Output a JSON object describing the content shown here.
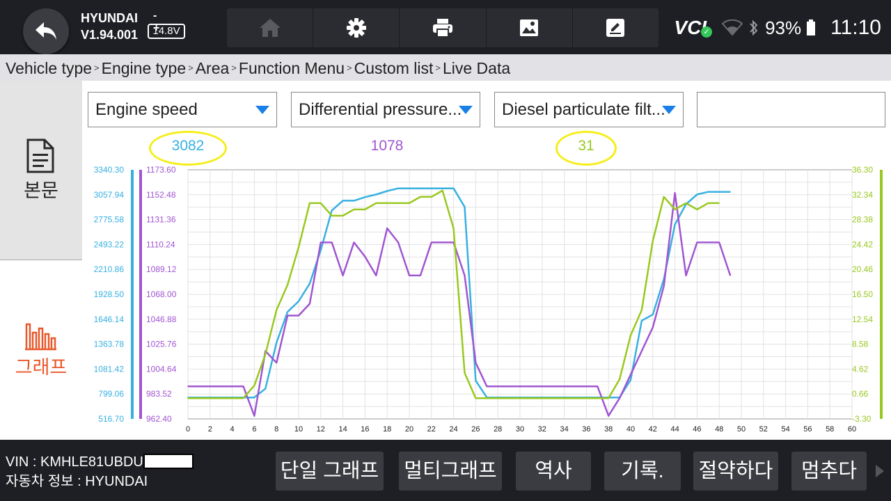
{
  "header": {
    "brand": "HYUNDAI",
    "version": "V1.94.001",
    "battery_signs": "- +",
    "voltage": "14.8V",
    "status_vci": "VCI",
    "battery_percent": "93%",
    "clock": "11:10",
    "toolbar_icons": [
      "home-icon",
      "gear-icon",
      "print-icon",
      "image-icon",
      "edit-icon"
    ]
  },
  "breadcrumb": [
    "Vehicle type",
    "Engine type",
    "Area",
    "Function Menu",
    "Custom list",
    "Live Data"
  ],
  "breadcrumb_separator": ">",
  "side": {
    "text_label": "본문",
    "graph_label": "그래프",
    "accent": "#e8582a"
  },
  "selectors": [
    {
      "label": "Engine speed"
    },
    {
      "label": "Differential pressure..."
    },
    {
      "label": "Diesel particulate filt..."
    },
    {
      "label": ""
    }
  ],
  "current_values": [
    "3082",
    "1078",
    "31"
  ],
  "chart_data": {
    "type": "line",
    "x_ticks": [
      0,
      2,
      4,
      6,
      8,
      10,
      12,
      14,
      16,
      18,
      20,
      22,
      24,
      26,
      28,
      30,
      32,
      34,
      36,
      38,
      40,
      42,
      44,
      46,
      48,
      50,
      52,
      54,
      56,
      58,
      60
    ],
    "xlim": [
      0,
      60
    ],
    "grid": true,
    "axes": [
      {
        "color": "#37b0e0",
        "ylim": [
          516.7,
          3340.3
        ],
        "ticks": [
          "3340.30",
          "3057.94",
          "2775.58",
          "2493.22",
          "2210.86",
          "1928.50",
          "1646.14",
          "1363.78",
          "1081.42",
          "799.06",
          "516.70"
        ]
      },
      {
        "color": "#a055d0",
        "ylim": [
          962.4,
          1173.6
        ],
        "ticks": [
          "1173.60",
          "1152.48",
          "1131.36",
          "1110.24",
          "1089.12",
          "1068.00",
          "1046.88",
          "1025.76",
          "1004.64",
          "983.52",
          "962.40"
        ]
      },
      {
        "color": "#99c81e",
        "ylim": [
          -3.3,
          36.3
        ],
        "ticks": [
          "36.30",
          "32.34",
          "28.38",
          "24.42",
          "20.46",
          "16.50",
          "12.54",
          "8.58",
          "4.62",
          "0.66",
          "-3.30"
        ]
      }
    ],
    "series": [
      {
        "axis": 0,
        "color": "#37b0e0",
        "points": [
          [
            0,
            760
          ],
          [
            5,
            760
          ],
          [
            6,
            760
          ],
          [
            7,
            860
          ],
          [
            8,
            1380
          ],
          [
            9,
            1730
          ],
          [
            10,
            1850
          ],
          [
            11,
            2050
          ],
          [
            12,
            2430
          ],
          [
            13,
            2880
          ],
          [
            14,
            2990
          ],
          [
            15,
            2990
          ],
          [
            16,
            3030
          ],
          [
            17,
            3060
          ],
          [
            18,
            3100
          ],
          [
            19,
            3130
          ],
          [
            20,
            3130
          ],
          [
            21,
            3130
          ],
          [
            22,
            3130
          ],
          [
            23,
            3130
          ],
          [
            24,
            3130
          ],
          [
            25,
            2920
          ],
          [
            26,
            950
          ],
          [
            27,
            760
          ],
          [
            28,
            760
          ],
          [
            37,
            760
          ],
          [
            38,
            760
          ],
          [
            39,
            760
          ],
          [
            40,
            960
          ],
          [
            41,
            1630
          ],
          [
            42,
            1700
          ],
          [
            43,
            2100
          ],
          [
            44,
            2720
          ],
          [
            45,
            2950
          ],
          [
            46,
            3060
          ],
          [
            47,
            3090
          ],
          [
            48,
            3090
          ],
          [
            49,
            3090
          ]
        ]
      },
      {
        "axis": 1,
        "color": "#a055d0",
        "points": [
          [
            0,
            990
          ],
          [
            5,
            990
          ],
          [
            6,
            965
          ],
          [
            7,
            1020
          ],
          [
            8,
            1010
          ],
          [
            9,
            1050
          ],
          [
            10,
            1050
          ],
          [
            11,
            1060
          ],
          [
            12,
            1112
          ],
          [
            13,
            1112
          ],
          [
            14,
            1084
          ],
          [
            15,
            1112
          ],
          [
            16,
            1100
          ],
          [
            17,
            1084
          ],
          [
            18,
            1124
          ],
          [
            19,
            1112
          ],
          [
            20,
            1084
          ],
          [
            21,
            1084
          ],
          [
            22,
            1112
          ],
          [
            23,
            1112
          ],
          [
            24,
            1112
          ],
          [
            25,
            1084
          ],
          [
            26,
            1010
          ],
          [
            27,
            990
          ],
          [
            28,
            990
          ],
          [
            37,
            990
          ],
          [
            38,
            965
          ],
          [
            39,
            980
          ],
          [
            40,
            1000
          ],
          [
            41,
            1020
          ],
          [
            42,
            1040
          ],
          [
            43,
            1075
          ],
          [
            44,
            1154
          ],
          [
            45,
            1084
          ],
          [
            46,
            1112
          ],
          [
            47,
            1112
          ],
          [
            48,
            1112
          ],
          [
            49,
            1084
          ]
        ]
      },
      {
        "axis": 2,
        "color": "#99c81e",
        "points": [
          [
            0,
            0
          ],
          [
            5,
            0
          ],
          [
            6,
            2
          ],
          [
            7,
            7
          ],
          [
            8,
            14
          ],
          [
            9,
            18
          ],
          [
            10,
            24
          ],
          [
            11,
            31
          ],
          [
            12,
            31
          ],
          [
            13,
            29
          ],
          [
            14,
            29
          ],
          [
            15,
            30
          ],
          [
            16,
            30
          ],
          [
            17,
            31
          ],
          [
            18,
            31
          ],
          [
            19,
            31
          ],
          [
            20,
            31
          ],
          [
            21,
            32
          ],
          [
            22,
            32
          ],
          [
            23,
            33
          ],
          [
            24,
            27
          ],
          [
            25,
            4
          ],
          [
            26,
            0
          ],
          [
            27,
            0
          ],
          [
            37,
            0
          ],
          [
            38,
            0
          ],
          [
            39,
            3
          ],
          [
            40,
            10
          ],
          [
            41,
            14
          ],
          [
            42,
            25
          ],
          [
            43,
            32
          ],
          [
            44,
            30
          ],
          [
            45,
            31
          ],
          [
            46,
            30
          ],
          [
            47,
            31
          ],
          [
            48,
            31
          ]
        ]
      }
    ]
  },
  "footer": {
    "vin_label": "VIN : KMHLE81UBDU",
    "info_label": "자동차 정보 : HYUNDAI",
    "buttons": [
      "단일 그래프",
      "멀티그래프",
      "역사",
      "기록.",
      "절약하다",
      "멈추다"
    ]
  }
}
